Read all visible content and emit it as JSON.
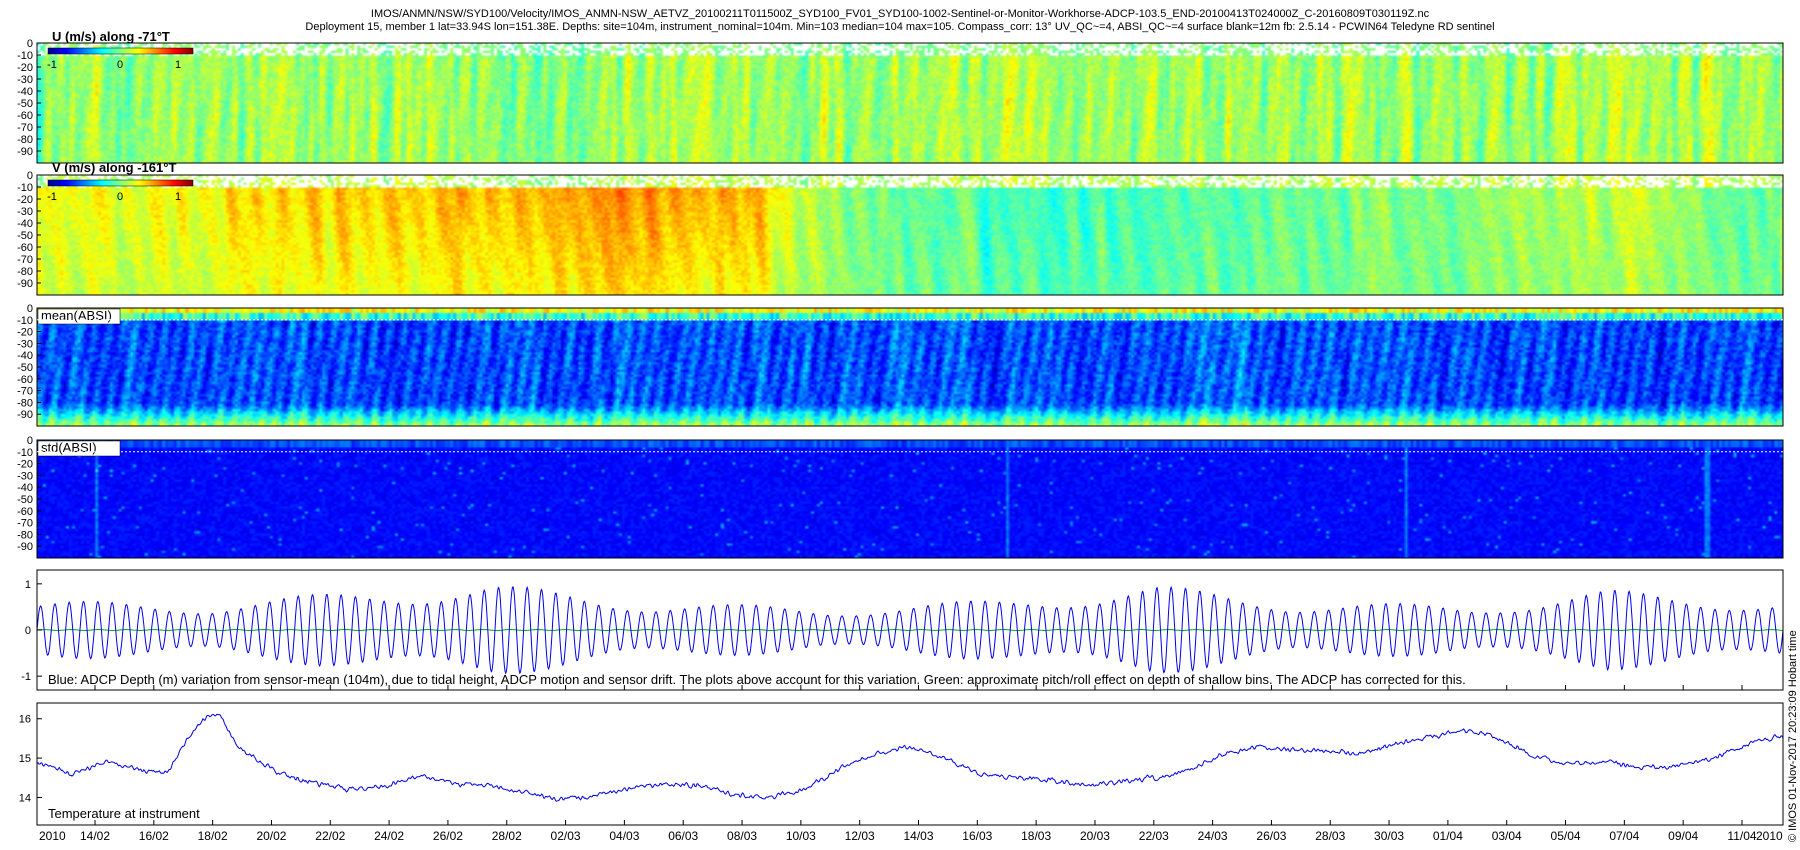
{
  "header": {
    "line1": "IMOS/ANMN/NSW/SYD100/Velocity/IMOS_ANMN-NSW_AETVZ_20100211T011500Z_SYD100_FV01_SYD100-1002-Sentinel-or-Monitor-Workhorse-ADCP-103.5_END-20100413T024000Z_C-20160809T030119Z.nc",
    "line2": "Deployment 15, member 1 lat=33.94S lon=151.38E. Depths: site=104m, instrument_nominal=104m. Min=103 median=104 max=105. Compass_corr: 13° UV_QC~=4, ABSI_QC~=4 surface blank=12m fb: 2.5.14 - PCWIN64 Teledyne RD sentinel"
  },
  "side_text": "© IMOS 01-Nov-2017 20:23:09 Hobart time",
  "colors": {
    "line_blue": "#0000ee",
    "line_green": "#00aa00"
  },
  "chart_data": [
    {
      "type": "heatmap",
      "id": "u",
      "label": "U (m/s) along -71°T",
      "colorbar_ticks": [
        "-1",
        "0",
        "1"
      ],
      "colormap": "jet",
      "clim": [
        -1,
        1
      ],
      "yticks": [
        "0",
        "-10",
        "-20",
        "-30",
        "-40",
        "-50",
        "-60",
        "-70",
        "-80",
        "-90"
      ],
      "ylim": [
        -100,
        0
      ],
      "profile": [
        [
          0,
          0.03
        ],
        [
          0.2,
          0.05
        ],
        [
          0.5,
          0.08
        ],
        [
          0.8,
          0.05
        ],
        [
          1,
          0.06
        ]
      ]
    },
    {
      "type": "heatmap",
      "id": "v",
      "label": "V (m/s) along -161°T",
      "colorbar_ticks": [
        "-1",
        "0",
        "1"
      ],
      "colormap": "jet",
      "clim": [
        -1,
        1
      ],
      "yticks": [
        "0",
        "-10",
        "-20",
        "-30",
        "-40",
        "-50",
        "-60",
        "-70",
        "-80",
        "-90"
      ],
      "ylim": [
        -100,
        0
      ],
      "profile": [
        [
          0,
          0.2
        ],
        [
          0.1,
          0.28
        ],
        [
          0.2,
          0.4
        ],
        [
          0.3,
          0.42
        ],
        [
          0.38,
          0.5
        ],
        [
          0.42,
          0.38
        ],
        [
          0.45,
          0.02
        ],
        [
          0.55,
          -0.12
        ],
        [
          0.7,
          -0.05
        ],
        [
          0.85,
          0.08
        ],
        [
          0.93,
          0.15
        ],
        [
          0.96,
          -0.08
        ],
        [
          1,
          -0.05
        ]
      ]
    },
    {
      "type": "heatmap",
      "id": "mean_absi",
      "label": "mean(ABSI)",
      "colormap": "jet",
      "clim": [
        0,
        1
      ],
      "yticks": [
        "0",
        "-10",
        "-20",
        "-30",
        "-40",
        "-50",
        "-60",
        "-70",
        "-80",
        "-90"
      ],
      "ylim": [
        -100,
        0
      ]
    },
    {
      "type": "heatmap",
      "id": "std_absi",
      "label": "std(ABSI)",
      "colormap": "jet",
      "clim": [
        0,
        1
      ],
      "yticks": [
        "0",
        "-10",
        "-20",
        "-30",
        "-40",
        "-50",
        "-60",
        "-70",
        "-80",
        "-90"
      ],
      "ylim": [
        -100,
        0
      ]
    },
    {
      "type": "line",
      "id": "depth",
      "caption": "Blue: ADCP Depth (m) variation from sensor-mean (104m), due to tidal height, ADCP motion and sensor drift. The plots above account for this variation. Green: approximate pitch/roll effect on depth of shallow bins. The ADCP has corrected for this.",
      "yticks": [
        "1",
        "0",
        "-1"
      ],
      "ylim": [
        -1.3,
        1.3
      ],
      "tidal_cycles": 122,
      "envelope": [
        [
          0,
          0.6
        ],
        [
          0.1,
          0.55
        ],
        [
          0.2,
          0.85
        ],
        [
          0.26,
          0.95
        ],
        [
          0.35,
          0.6
        ],
        [
          0.45,
          0.45
        ],
        [
          0.55,
          0.62
        ],
        [
          0.64,
          0.92
        ],
        [
          0.72,
          0.6
        ],
        [
          0.82,
          0.5
        ],
        [
          0.9,
          0.82
        ],
        [
          1,
          0.6
        ]
      ],
      "series": [
        {
          "name": "Blue",
          "color": "#0000ee"
        },
        {
          "name": "Green",
          "color": "#00aa00"
        }
      ]
    },
    {
      "type": "line",
      "id": "temperature",
      "caption": "Temperature at instrument",
      "yticks": [
        "16",
        "15",
        "14"
      ],
      "ylim": [
        13.3,
        16.4
      ],
      "x": [
        0,
        0.02,
        0.04,
        0.06,
        0.075,
        0.085,
        0.095,
        0.105,
        0.115,
        0.125,
        0.135,
        0.15,
        0.165,
        0.18,
        0.2,
        0.22,
        0.24,
        0.26,
        0.28,
        0.3,
        0.32,
        0.34,
        0.36,
        0.38,
        0.4,
        0.42,
        0.44,
        0.46,
        0.48,
        0.5,
        0.52,
        0.54,
        0.56,
        0.58,
        0.6,
        0.62,
        0.64,
        0.66,
        0.68,
        0.7,
        0.72,
        0.74,
        0.76,
        0.78,
        0.8,
        0.82,
        0.84,
        0.86,
        0.88,
        0.9,
        0.92,
        0.94,
        0.96,
        0.98,
        1.0
      ],
      "y": [
        14.9,
        14.6,
        14.9,
        14.7,
        14.65,
        15.4,
        16.0,
        16.1,
        15.3,
        15.0,
        14.7,
        14.45,
        14.3,
        14.2,
        14.3,
        14.55,
        14.35,
        14.3,
        14.1,
        13.95,
        14.05,
        14.25,
        14.35,
        14.3,
        14.05,
        14.0,
        14.2,
        14.75,
        15.1,
        15.3,
        15.0,
        14.6,
        14.5,
        14.45,
        14.3,
        14.4,
        14.5,
        14.7,
        15.1,
        15.3,
        15.2,
        15.2,
        15.1,
        15.4,
        15.55,
        15.7,
        15.45,
        15.0,
        14.85,
        14.9,
        14.75,
        14.8,
        15.0,
        15.35,
        15.6
      ],
      "series": [
        {
          "name": "",
          "color": "#0000ee"
        }
      ]
    }
  ],
  "x_axis": {
    "ticks": [
      "14/02",
      "16/02",
      "18/02",
      "20/02",
      "22/02",
      "24/02",
      "26/02",
      "28/02",
      "02/03",
      "04/03",
      "06/03",
      "08/03",
      "10/03",
      "12/03",
      "14/03",
      "16/03",
      "18/03",
      "20/03",
      "22/03",
      "24/03",
      "26/03",
      "28/03",
      "30/03",
      "01/04",
      "03/04",
      "05/04",
      "07/04",
      "09/04",
      "11/04"
    ],
    "start_label": "2010",
    "end_label": "2010"
  }
}
